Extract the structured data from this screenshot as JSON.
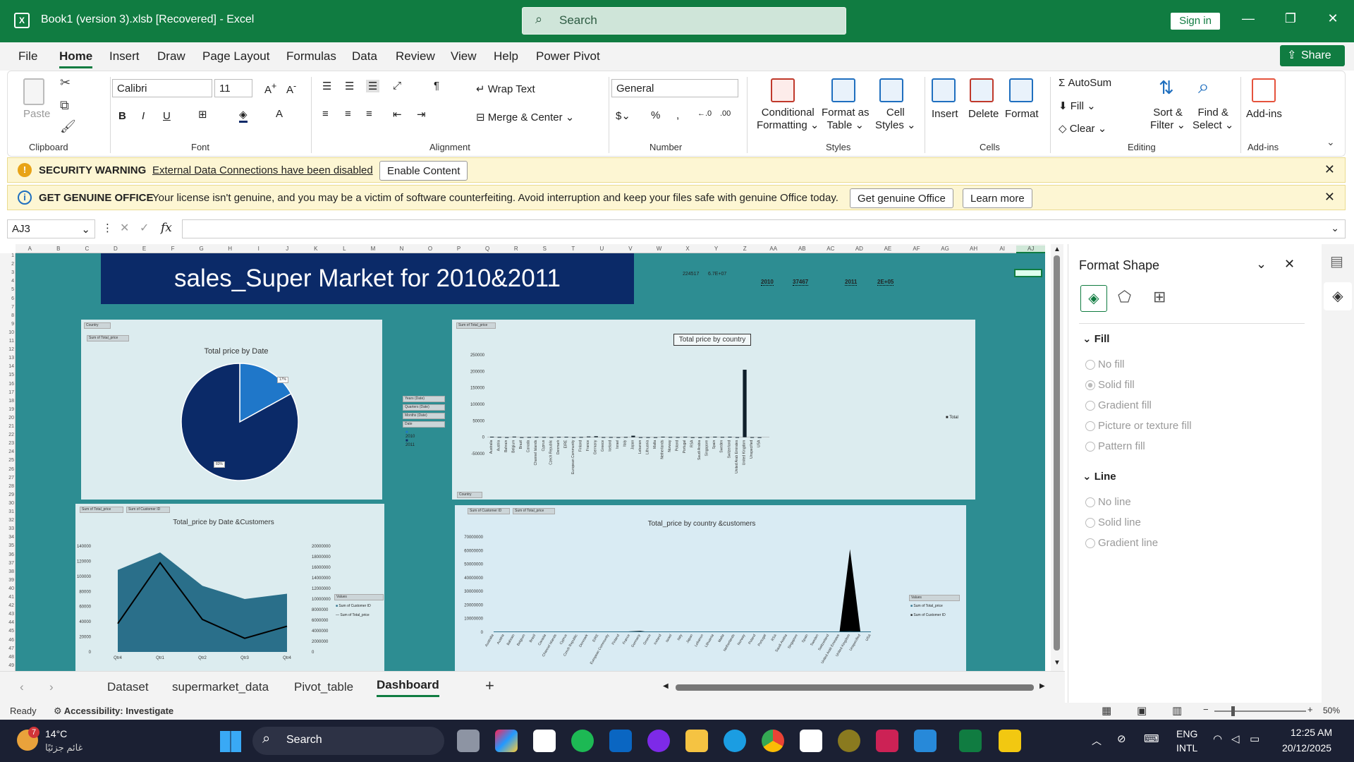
{
  "title_bar": {
    "title": "Book1 (version 3).xlsb [Recovered]  -  Excel",
    "search_placeholder": "Search",
    "signin": "Sign in"
  },
  "menu": {
    "items": [
      "File",
      "Home",
      "Insert",
      "Draw",
      "Page Layout",
      "Formulas",
      "Data",
      "Review",
      "View",
      "Help",
      "Power Pivot"
    ],
    "share": "Share"
  },
  "ribbon": {
    "clipboard": {
      "paste": "Paste",
      "label": "Clipboard"
    },
    "font": {
      "name": "Calibri",
      "size": "11",
      "label": "Font"
    },
    "alignment": {
      "wrap": "Wrap Text",
      "merge": "Merge & Center",
      "label": "Alignment"
    },
    "number": {
      "format": "General",
      "label": "Number"
    },
    "styles": {
      "cond1": "Conditional",
      "cond2": "Formatting",
      "fmt1": "Format as",
      "fmt2": "Table",
      "cell1": "Cell",
      "cell2": "Styles",
      "label": "Styles"
    },
    "cells": {
      "insert": "Insert",
      "delete": "Delete",
      "format": "Format",
      "label": "Cells"
    },
    "editing": {
      "autosum": "AutoSum",
      "fill": "Fill",
      "clear": "Clear",
      "sort1": "Sort &",
      "sort2": "Filter",
      "find1": "Find &",
      "find2": "Select",
      "label": "Editing"
    },
    "addins": {
      "label_top": "Add-ins",
      "label": "Add-ins"
    }
  },
  "security_warning": {
    "title": "SECURITY WARNING",
    "message": "External Data Connections have been disabled",
    "button": "Enable Content"
  },
  "genuine_warning": {
    "title": "GET GENUINE OFFICE",
    "message": "Your license isn't genuine, and you may be a victim of software counterfeiting. Avoid interruption and keep your files safe with genuine Office today.",
    "btn1": "Get genuine Office",
    "btn2": "Learn more"
  },
  "formula_bar": {
    "name_box": "AJ3",
    "fx": "fx",
    "value": ""
  },
  "columns": [
    "A",
    "B",
    "C",
    "D",
    "E",
    "F",
    "G",
    "H",
    "I",
    "J",
    "K",
    "L",
    "M",
    "N",
    "O",
    "P",
    "Q",
    "R",
    "S",
    "T",
    "U",
    "V",
    "W",
    "X",
    "Y",
    "Z",
    "AA",
    "AB",
    "AC",
    "AD",
    "AE",
    "AF",
    "AG",
    "AH",
    "AI",
    "AJ"
  ],
  "dashboard": {
    "banner": "sales_Super Market for 2010&2011",
    "cells": {
      "a": "224517",
      "b": "6.7E+07",
      "y1": "2010",
      "v1": "37467",
      "y2": "2011",
      "v2": "2E+05"
    },
    "pie": {
      "title": "Total price by Date",
      "field1": "Country",
      "field2": "Sum of Total_price",
      "label_small": "17%",
      "label_big": "83%",
      "slicers": [
        "Years (Date)",
        "Quarters (Date)",
        "Months (Date)",
        "Date"
      ],
      "legend": [
        "2010",
        "2011"
      ]
    },
    "bar": {
      "title": "Total price by country",
      "field1": "Sum of Total_price",
      "field2": "Country",
      "legend": "Total",
      "yticks": [
        "250000",
        "200000",
        "150000",
        "100000",
        "50000",
        "0",
        "-50000"
      ]
    },
    "area": {
      "title": "Total_price by Date &Customers",
      "fields": [
        "Sum of Total_price",
        "Sum of Customer ID"
      ],
      "left_ticks": [
        "140000",
        "120000",
        "100000",
        "80000",
        "60000",
        "40000",
        "20000",
        "0"
      ],
      "right_ticks": [
        "20000000",
        "18000000",
        "16000000",
        "14000000",
        "12000000",
        "10000000",
        "8000000",
        "6000000",
        "4000000",
        "2000000",
        "0"
      ],
      "xcats": [
        "Qtr4",
        "Qtr1",
        "Qtr2",
        "Qtr3",
        "Qtr4"
      ],
      "legend_title": "Values",
      "legend": [
        "Sum of Customer ID",
        "Sum of Total_price"
      ]
    },
    "country2": {
      "title": "Total_price by country &customers",
      "fields": [
        "Sum of Customer ID",
        "Sum of Total_price"
      ],
      "yticks": [
        "70000000",
        "60000000",
        "50000000",
        "40000000",
        "30000000",
        "20000000",
        "10000000",
        "0"
      ],
      "legend_title": "Values",
      "legend": [
        "Sum of Total_price",
        "Sum of Customer ID"
      ]
    }
  },
  "chart_data": [
    {
      "type": "pie",
      "title": "Total price by Date",
      "categories": [
        "2010",
        "2011"
      ],
      "values": [
        17,
        83
      ],
      "colors": [
        "#1f77c9",
        "#0b2a68"
      ]
    },
    {
      "type": "bar",
      "title": "Total price by country",
      "ylim": [
        -50000,
        250000
      ],
      "categories": [
        "Australia",
        "Austria",
        "Bahrain",
        "Belgium",
        "Brazil",
        "Canada",
        "Channel Islands",
        "Cyprus",
        "Czech Republic",
        "Denmark",
        "EIRE",
        "European Community",
        "Finland",
        "France",
        "Germany",
        "Greece",
        "Iceland",
        "Israel",
        "Italy",
        "Japan",
        "Lebanon",
        "Lithuania",
        "Malta",
        "Netherlands",
        "Norway",
        "Poland",
        "Portugal",
        "RSA",
        "Saudi Arabia",
        "Singapore",
        "Spain",
        "Sweden",
        "Switzerland",
        "United Arab Emirates",
        "United Kingdom",
        "Unspecified",
        "USA"
      ],
      "series": [
        {
          "name": "Total",
          "values": [
            1500,
            800,
            200,
            1800,
            150,
            600,
            900,
            700,
            300,
            1000,
            1200,
            100,
            700,
            2200,
            3000,
            400,
            500,
            200,
            800,
            4500,
            200,
            200,
            100,
            1500,
            700,
            400,
            1200,
            50,
            20,
            500,
            1500,
            900,
            1300,
            200,
            205000,
            300,
            100
          ]
        }
      ]
    },
    {
      "type": "area",
      "title": "Total_price by Date &Customers",
      "categories": [
        "Qtr4",
        "Qtr1",
        "Qtr2",
        "Qtr3",
        "Qtr4"
      ],
      "series": [
        {
          "name": "Sum of Customer ID",
          "values": [
            15500000,
            18800000,
            12500000,
            10000000,
            11000000
          ]
        },
        {
          "name": "Sum of Total_price",
          "values": [
            37467,
            118000,
            43000,
            18000,
            34000
          ]
        }
      ]
    },
    {
      "type": "area",
      "title": "Total_price by country &customers",
      "ylim": [
        0,
        70000000
      ],
      "categories": [
        "Australia",
        "Austria",
        "Bahrain",
        "Belgium",
        "Brazil",
        "Canada",
        "Channel Islands",
        "Cyprus",
        "Czech Republic",
        "Denmark",
        "EIRE",
        "European Community",
        "Finland",
        "France",
        "Germany",
        "Greece",
        "Iceland",
        "Israel",
        "Italy",
        "Japan",
        "Lebanon",
        "Lithuania",
        "Malta",
        "Netherlands",
        "Norway",
        "Poland",
        "Portugal",
        "RSA",
        "Saudi Arabia",
        "Singapore",
        "Spain",
        "Sweden",
        "Switzerland",
        "United Arab Emirates",
        "United Kingdom",
        "Unspecified",
        "USA"
      ],
      "series": [
        {
          "name": "Sum of Total_price",
          "values": [
            0,
            0,
            0,
            0,
            0,
            0,
            0,
            0,
            0,
            0,
            0,
            0,
            0,
            0,
            0,
            0,
            0,
            0,
            0,
            0,
            0,
            0,
            0,
            0,
            0,
            0,
            0,
            0,
            0,
            0,
            0,
            0,
            0,
            0,
            200000,
            0,
            0
          ]
        },
        {
          "name": "Sum of Customer ID",
          "values": [
            100000,
            80000,
            10000,
            150000,
            10000,
            50000,
            80000,
            50000,
            20000,
            90000,
            200000,
            10000,
            70000,
            600000,
            900000,
            20000,
            30000,
            10000,
            100000,
            50000,
            10000,
            10000,
            5000,
            100000,
            60000,
            30000,
            100000,
            5000,
            2000,
            40000,
            120000,
            80000,
            120000,
            10000,
            61000000,
            20000,
            10000
          ]
        }
      ]
    }
  ],
  "sheet_tabs": [
    "Dataset",
    "supermarket_data",
    "Pivot_table",
    "Dashboard"
  ],
  "status": {
    "ready": "Ready",
    "accessibility": "Accessibility: Investigate",
    "zoom": "50%"
  },
  "format_pane": {
    "title": "Format Shape",
    "fill": "Fill",
    "fill_options": [
      "No fill",
      "Solid fill",
      "Gradient fill",
      "Picture or texture fill",
      "Pattern fill"
    ],
    "line": "Line",
    "line_options": [
      "No line",
      "Solid line",
      "Gradient line"
    ]
  },
  "taskbar": {
    "temp": "14°C",
    "weather": "غائم جزئيًا",
    "badge": "7",
    "search": "Search",
    "lang1": "ENG",
    "lang2": "INTL",
    "time": "12:25 AM",
    "date": "20/12/2025"
  },
  "colors": {
    "excel_green": "#107c41",
    "dashboard_bg": "#2d8d92",
    "banner": "#0b2a68",
    "series_blue": "#2a6f8a"
  }
}
